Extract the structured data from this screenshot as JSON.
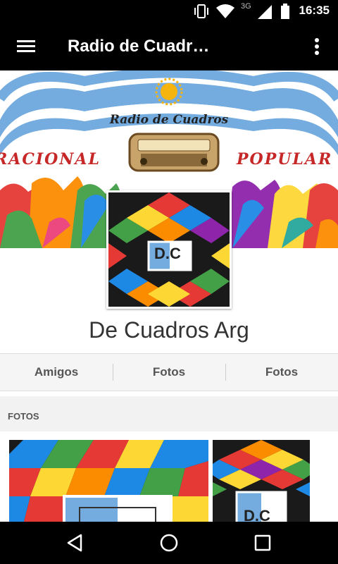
{
  "status_bar": {
    "time": "16:35",
    "network": "3G"
  },
  "toolbar": {
    "title": "Radio de Cuadr…"
  },
  "cover": {
    "title": "Radio de Cuadros",
    "left_word": "RACIONAL",
    "right_word": "POPULAR"
  },
  "profile": {
    "name": "De Cuadros Arg",
    "avatar_text": "D.C"
  },
  "tabs": [
    {
      "label": "Amigos"
    },
    {
      "label": "Fotos"
    },
    {
      "label": "Fotos"
    }
  ],
  "photos_section": {
    "heading": "FOTOS"
  },
  "colors": {
    "bar": "#000000",
    "flag_blue": "#74ACDF",
    "sun": "#F6B40E",
    "tab_bg": "#F5F5F5"
  },
  "icons": [
    "menu-icon",
    "more-vert-icon",
    "vibrate-icon",
    "wifi-icon",
    "signal-icon",
    "battery-icon",
    "back-icon",
    "home-icon",
    "recents-icon"
  ]
}
